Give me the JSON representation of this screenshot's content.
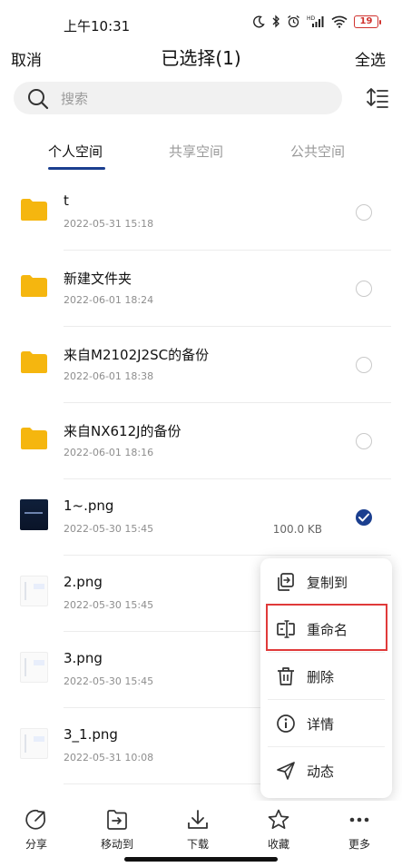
{
  "status_bar": {
    "time": "上午10:31",
    "battery": "19",
    "icons": [
      "moon-icon",
      "bluetooth-icon",
      "alarm-icon",
      "signal-icon",
      "wifi-icon",
      "battery-icon"
    ]
  },
  "header": {
    "cancel_label": "取消",
    "title": "已选择(1)",
    "select_all_label": "全选"
  },
  "search": {
    "placeholder": "搜索"
  },
  "tabs": [
    {
      "label": "个人空间",
      "active": true
    },
    {
      "label": "共享空间",
      "active": false
    },
    {
      "label": "公共空间",
      "active": false
    }
  ],
  "files": [
    {
      "name": "t",
      "date": "2022-05-31 15:18",
      "size": "",
      "type": "folder",
      "selected": false
    },
    {
      "name": "新建文件夹",
      "date": "2022-06-01 18:24",
      "size": "",
      "type": "folder",
      "selected": false
    },
    {
      "name": "来自M2102J2SC的备份",
      "date": "2022-06-01 18:38",
      "size": "",
      "type": "folder",
      "selected": false
    },
    {
      "name": "来自NX612J的备份",
      "date": "2022-06-01 18:16",
      "size": "",
      "type": "folder",
      "selected": false
    },
    {
      "name": "1~.png",
      "date": "2022-05-30 15:45",
      "size": "100.0 KB",
      "type": "image-dark",
      "selected": true
    },
    {
      "name": "2.png",
      "date": "2022-05-30 15:45",
      "size": "",
      "type": "image-light",
      "selected": false
    },
    {
      "name": "3.png",
      "date": "2022-05-30 15:45",
      "size": "",
      "type": "image-light",
      "selected": false
    },
    {
      "name": "3_1.png",
      "date": "2022-05-31 10:08",
      "size": "",
      "type": "image-light",
      "selected": false
    }
  ],
  "popup_menu": {
    "items": [
      {
        "label": "复制到",
        "icon": "copy-to-icon"
      },
      {
        "label": "重命名",
        "icon": "rename-icon",
        "highlighted": true
      },
      {
        "label": "删除",
        "icon": "trash-icon"
      },
      {
        "label": "详情",
        "icon": "info-icon"
      },
      {
        "label": "动态",
        "icon": "send-icon"
      }
    ]
  },
  "bottom_bar": {
    "items": [
      {
        "label": "分享",
        "icon": "share-icon"
      },
      {
        "label": "移动到",
        "icon": "move-to-icon"
      },
      {
        "label": "下载",
        "icon": "download-icon"
      },
      {
        "label": "收藏",
        "icon": "star-icon"
      },
      {
        "label": "更多",
        "icon": "more-icon"
      }
    ]
  },
  "colors": {
    "accent": "#1b3f8f",
    "folder": "#f5b60f",
    "highlight_border": "#e03a3a",
    "battery_low": "#d0322e"
  }
}
